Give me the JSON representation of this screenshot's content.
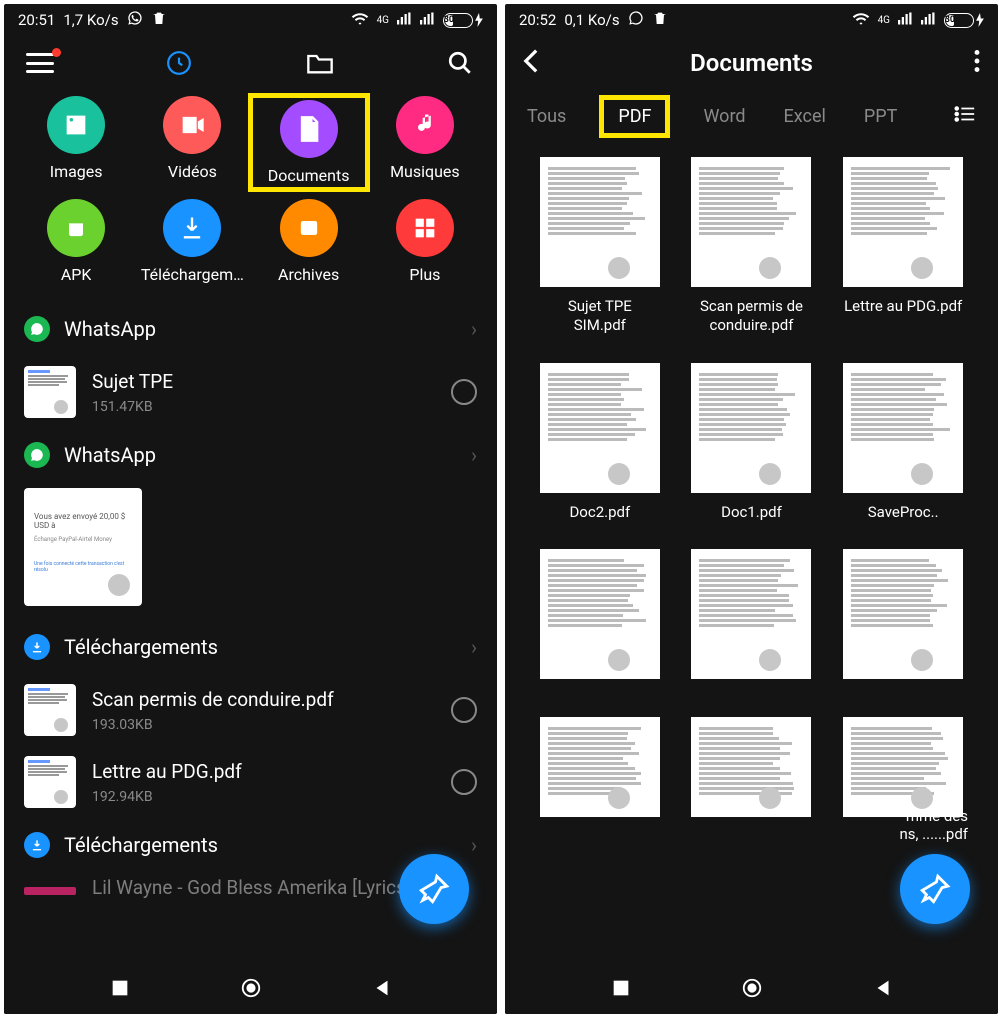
{
  "left": {
    "status": {
      "time": "20:51",
      "speed": "1,7 Ko/s",
      "net": "4G",
      "battery": "30"
    },
    "cats": [
      {
        "label": "Images",
        "color": "#19c29c",
        "icon": "image"
      },
      {
        "label": "Vidéos",
        "color": "#ff5a5a",
        "icon": "video"
      },
      {
        "label": "Documents",
        "color": "#a44cff",
        "icon": "doc",
        "hl": true
      },
      {
        "label": "Musiques",
        "color": "#ff2a82",
        "icon": "music"
      },
      {
        "label": "APK",
        "color": "#6bd12f",
        "icon": "android"
      },
      {
        "label": "Téléchargem…",
        "color": "#1993ff",
        "icon": "download"
      },
      {
        "label": "Archives",
        "color": "#ff8a00",
        "icon": "zip"
      },
      {
        "label": "Plus",
        "color": "#ff3a3a",
        "icon": "grid"
      }
    ],
    "sections": [
      {
        "type": "head",
        "icon": "whatsapp",
        "iconbg": "#1bb752",
        "title": "WhatsApp"
      },
      {
        "type": "file",
        "name": "Sujet TPE",
        "size": "151.47KB"
      },
      {
        "type": "head",
        "icon": "whatsapp",
        "iconbg": "#1bb752",
        "title": "WhatsApp"
      },
      {
        "type": "big",
        "text": "Vous avez envoyé 20,00 $ USD à"
      },
      {
        "type": "head",
        "icon": "download",
        "iconbg": "#1993ff",
        "title": "Téléchargements"
      },
      {
        "type": "file",
        "name": "Scan permis de conduire.pdf",
        "size": "193.03KB"
      },
      {
        "type": "file",
        "name": "Lettre au PDG.pdf",
        "size": "192.94KB"
      },
      {
        "type": "head",
        "icon": "download",
        "iconbg": "#1993ff",
        "title": "Téléchargements"
      },
      {
        "type": "cut",
        "name": "Lil Wayne - God Bless Amerika [Lyrics"
      }
    ]
  },
  "right": {
    "status": {
      "time": "20:52",
      "speed": "0,1 Ko/s",
      "net": "4G",
      "battery": "30"
    },
    "title": "Documents",
    "tabs": [
      {
        "label": "Tous"
      },
      {
        "label": "PDF",
        "hl": true
      },
      {
        "label": "Word"
      },
      {
        "label": "Excel"
      },
      {
        "label": "PPT"
      }
    ],
    "docs": [
      {
        "label": "Sujet TPE\nSIM.pdf"
      },
      {
        "label": "Scan permis de\nconduire.pdf"
      },
      {
        "label": "Lettre au PDG.pdf"
      },
      {
        "label": "Doc2.pdf"
      },
      {
        "label": "Doc1.pdf"
      },
      {
        "label": "SaveProc.."
      },
      {
        "label": ""
      },
      {
        "label": ""
      },
      {
        "label": ""
      }
    ],
    "truncated": "mme des\nns, ......pdf"
  }
}
